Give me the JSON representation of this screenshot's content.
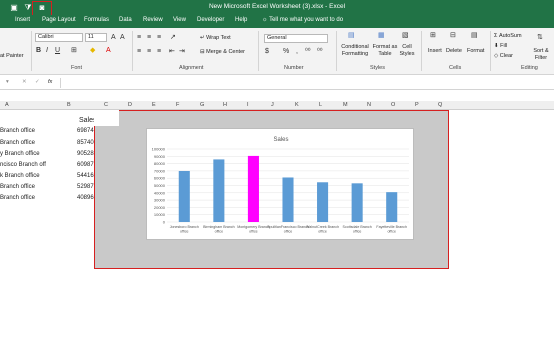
{
  "window": {
    "title": "New Microsoft Excel Worksheet (3).xlsx  -  Excel"
  },
  "tabs": [
    "Insert",
    "Page Layout",
    "Formulas",
    "Data",
    "Review",
    "View",
    "Developer",
    "Help"
  ],
  "tell_me": "Tell me what you want to do",
  "ribbon": {
    "clipboard": {
      "format_painter": "at Painter"
    },
    "font": {
      "name": "Calibri",
      "size": "11",
      "group": "Font"
    },
    "alignment": {
      "wrap": "Wrap Text",
      "merge": "Merge & Center",
      "group": "Alignment"
    },
    "number": {
      "format": "General",
      "group": "Number"
    },
    "styles": {
      "conditional": "Conditional Formatting",
      "format_table": "Format as Table",
      "cell_styles": "Cell Styles",
      "group": "Styles"
    },
    "cells": {
      "insert": "Insert",
      "delete": "Delete",
      "format": "Format",
      "group": "Cells"
    },
    "editing": {
      "autosum": "AutoSum",
      "fill": "Fill",
      "clear": "Clear",
      "sort": "Sort & Filter",
      "group": "Editing"
    }
  },
  "formula_bar": {
    "fx": "fx"
  },
  "columns": [
    "A",
    "B",
    "C",
    "D",
    "E",
    "F",
    "G",
    "H",
    "I",
    "J",
    "K",
    "L",
    "M",
    "N",
    "O",
    "P",
    "Q"
  ],
  "sheet": {
    "header": "Sales",
    "rows": [
      {
        "label": "Branch office",
        "value": "69874"
      },
      {
        "label": "Branch office",
        "value": "85740"
      },
      {
        "label": "y Branch office",
        "value": "90528"
      },
      {
        "label": "ncisco Branch off",
        "value": "60987"
      },
      {
        "label": "k Branch office",
        "value": "54416"
      },
      {
        "label": "Branch office",
        "value": "52987"
      },
      {
        "label": "Branch office",
        "value": "40896"
      }
    ]
  },
  "chart_data": {
    "type": "bar",
    "title": "Sales",
    "categories": [
      "Jonesboro Branch office",
      "Birmingham Branch office",
      "Montgomery Branch office",
      "SpuiltlanFrancisco Branch office",
      "WalnutCreek Branch office",
      "Scottsdale Branch office",
      "Fayetteville Branch office"
    ],
    "values": [
      69874,
      85740,
      90528,
      60987,
      54416,
      52987,
      40896
    ],
    "ylim": [
      0,
      100000
    ],
    "yticks": [
      "0",
      "10000",
      "20000",
      "30000",
      "40000",
      "50000",
      "60000",
      "70000",
      "80000",
      "90000",
      "100000"
    ],
    "colors": {
      "default": "#5b9bd5",
      "highlight": "#ff00ff"
    },
    "highlight_index": 2
  }
}
